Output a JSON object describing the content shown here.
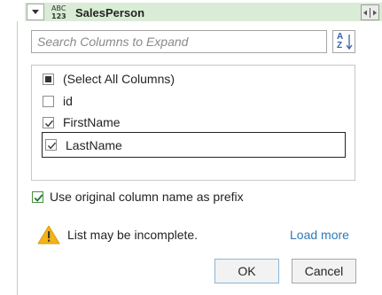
{
  "column_header": {
    "type_icon_line1": "ABC",
    "type_icon_line2": "123",
    "column_name": "SalesPerson"
  },
  "search": {
    "placeholder": "Search Columns to Expand",
    "value": ""
  },
  "column_list": {
    "items": [
      {
        "label": "(Select All Columns)",
        "state": "indeterminate"
      },
      {
        "label": "id",
        "state": "unchecked"
      },
      {
        "label": "FirstName",
        "state": "checked"
      },
      {
        "label": "LastName",
        "state": "checked",
        "focused": true
      }
    ]
  },
  "prefix_option": {
    "label": "Use original column name as prefix",
    "checked": true
  },
  "warning": {
    "text": "List may be incomplete.",
    "link_label": "Load more"
  },
  "buttons": {
    "ok_label": "OK",
    "cancel_label": "Cancel"
  },
  "colors": {
    "header_bg": "#d9ecd5",
    "accent_green": "#217346",
    "link_blue": "#2e7ab8",
    "warning_yellow": "#f3b417"
  }
}
